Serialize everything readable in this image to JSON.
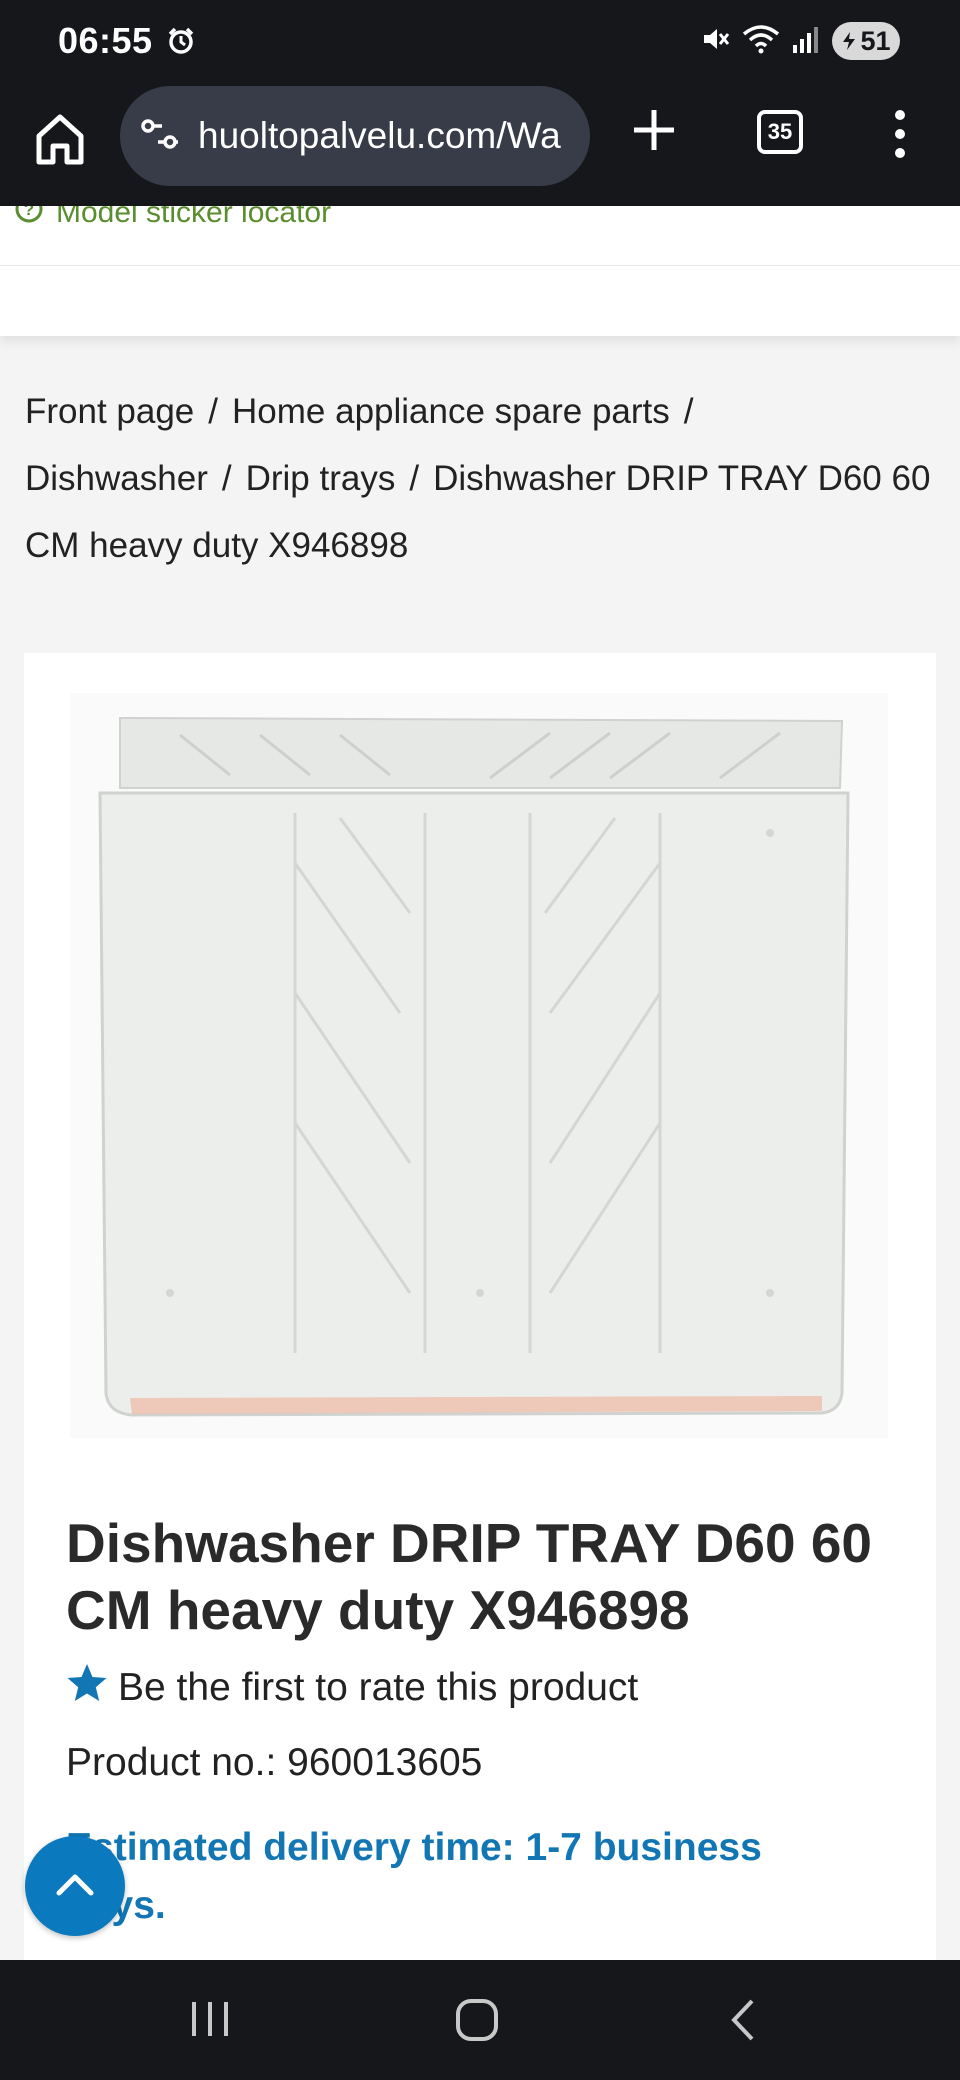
{
  "status_bar": {
    "time": "06:55",
    "battery_level": "51",
    "icons": [
      "alarm-icon",
      "mute-icon",
      "wifi-icon",
      "signal-icon",
      "battery-icon"
    ]
  },
  "browser": {
    "url": "huoltopalvelu.com/Wa",
    "tab_count": "35",
    "icons": [
      "home-icon",
      "site-settings-icon",
      "new-tab-icon",
      "tab-switcher-icon",
      "more-menu-icon"
    ]
  },
  "header": {
    "locator_label": "Model sticker locator"
  },
  "breadcrumb": [
    "Front page",
    "Home appliance spare parts",
    "Dishwasher",
    "Drip trays",
    "Dishwasher DRIP TRAY D60 60 CM heavy duty X946898"
  ],
  "product": {
    "image_icon": "drip-tray-image",
    "title": "Dishwasher DRIP TRAY D60 60 CM heavy duty X946898",
    "rating_text": "Be the first to rate this product",
    "product_no": "Product no.: 960013605",
    "delivery": "Estimated delivery time: 1-7 business days."
  },
  "colors": {
    "accent_blue": "#1176b3",
    "scroll_button": "#0a79bd",
    "locator_green": "#5a8d2e",
    "system_bar": "#15171b"
  }
}
